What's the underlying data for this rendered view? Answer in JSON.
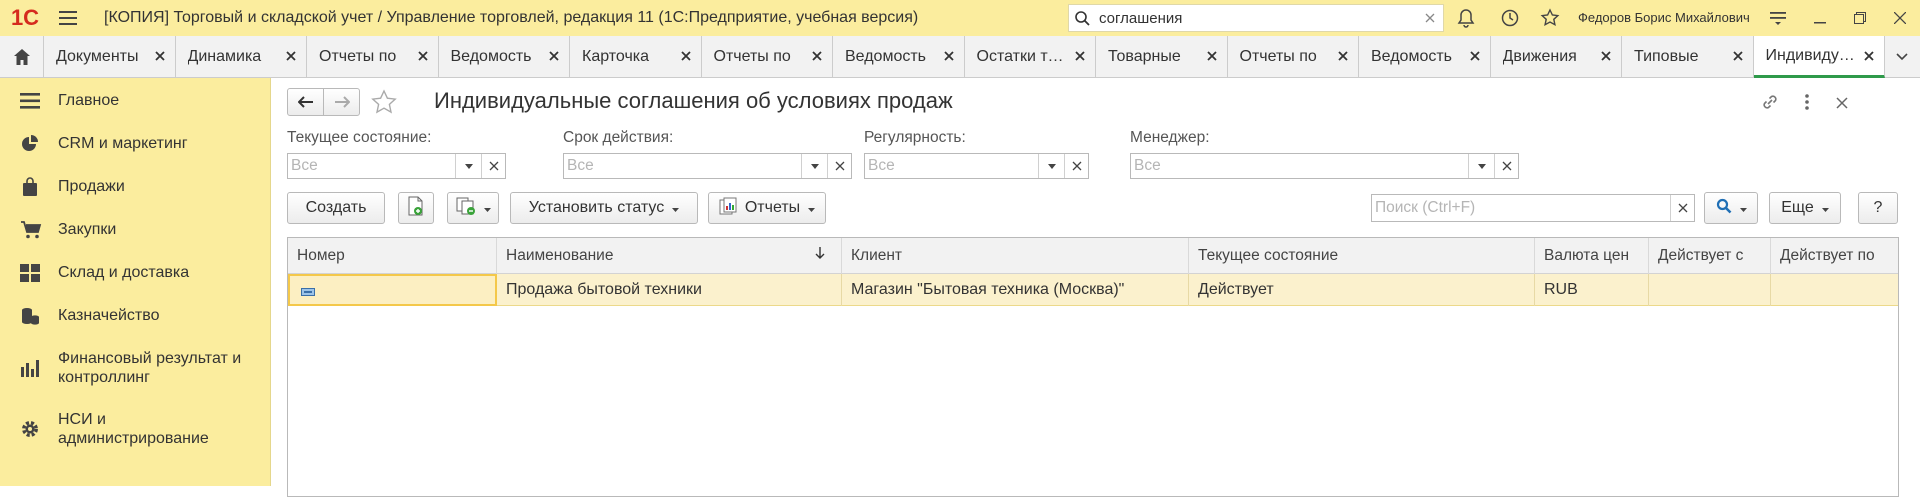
{
  "app": {
    "logo_text": "1С",
    "window_title": "[КОПИЯ] Торговый и складской учет / Управление торговлей, редакция 11  (1С:Предприятие, учебная версия)",
    "search_value": "соглашения",
    "user_name": "Федоров Борис Михайлович"
  },
  "tabs": [
    {
      "label": "Документы"
    },
    {
      "label": "Динамика"
    },
    {
      "label": "Отчеты по"
    },
    {
      "label": "Ведомость"
    },
    {
      "label": "Карточка"
    },
    {
      "label": "Отчеты по"
    },
    {
      "label": "Ведомость"
    },
    {
      "label": "Остатки товаров"
    },
    {
      "label": "Товарные"
    },
    {
      "label": "Отчеты по"
    },
    {
      "label": "Ведомость"
    },
    {
      "label": "Движения"
    },
    {
      "label": "Типовые"
    },
    {
      "label": "Индивидуальные",
      "active": true
    }
  ],
  "sidebar": {
    "items": [
      {
        "label": "Главное",
        "icon": "menu-lines-icon"
      },
      {
        "label": "CRM и маркетинг",
        "icon": "pie-chart-icon"
      },
      {
        "label": "Продажи",
        "icon": "shopping-bag-icon"
      },
      {
        "label": "Закупки",
        "icon": "cart-icon"
      },
      {
        "label": "Склад и доставка",
        "icon": "warehouse-grid-icon"
      },
      {
        "label": "Казначейство",
        "icon": "coins-icon"
      },
      {
        "label": "Финансовый результат и контроллинг",
        "icon": "bar-chart-icon"
      },
      {
        "label": "НСИ и администрирование",
        "icon": "gear-icon"
      }
    ]
  },
  "form": {
    "title": "Индивидуальные соглашения об условиях продаж",
    "filters": {
      "state": {
        "label": "Текущее состояние:",
        "value": "Все"
      },
      "term": {
        "label": "Срок действия:",
        "value": "Все"
      },
      "regularity": {
        "label": "Регулярность:",
        "value": "Все"
      },
      "manager": {
        "label": "Менеджер:",
        "value": "Все"
      }
    },
    "toolbar": {
      "create": "Создать",
      "set_status": "Установить статус",
      "reports": "Отчеты",
      "search_placeholder": "Поиск (Ctrl+F)",
      "more": "Еще",
      "help": "?"
    }
  },
  "table": {
    "columns": [
      "Номер",
      "Наименование",
      "Клиент",
      "Текущее состояние",
      "Валюта цен",
      "Действует с",
      "Действует по"
    ],
    "rows": [
      {
        "number": "",
        "name": "Продажа бытовой техники",
        "client": "Магазин \"Бытовая техника (Москва)\"",
        "state": "Действует",
        "currency": "RUB",
        "from": "",
        "to": ""
      }
    ]
  },
  "colors": {
    "title_bar": "#fbed9e",
    "sidebar": "#fbed9e",
    "selected_row": "#fbf1cd",
    "active_tab_underline": "#2e9a4a",
    "logo": "#d52b1e"
  }
}
